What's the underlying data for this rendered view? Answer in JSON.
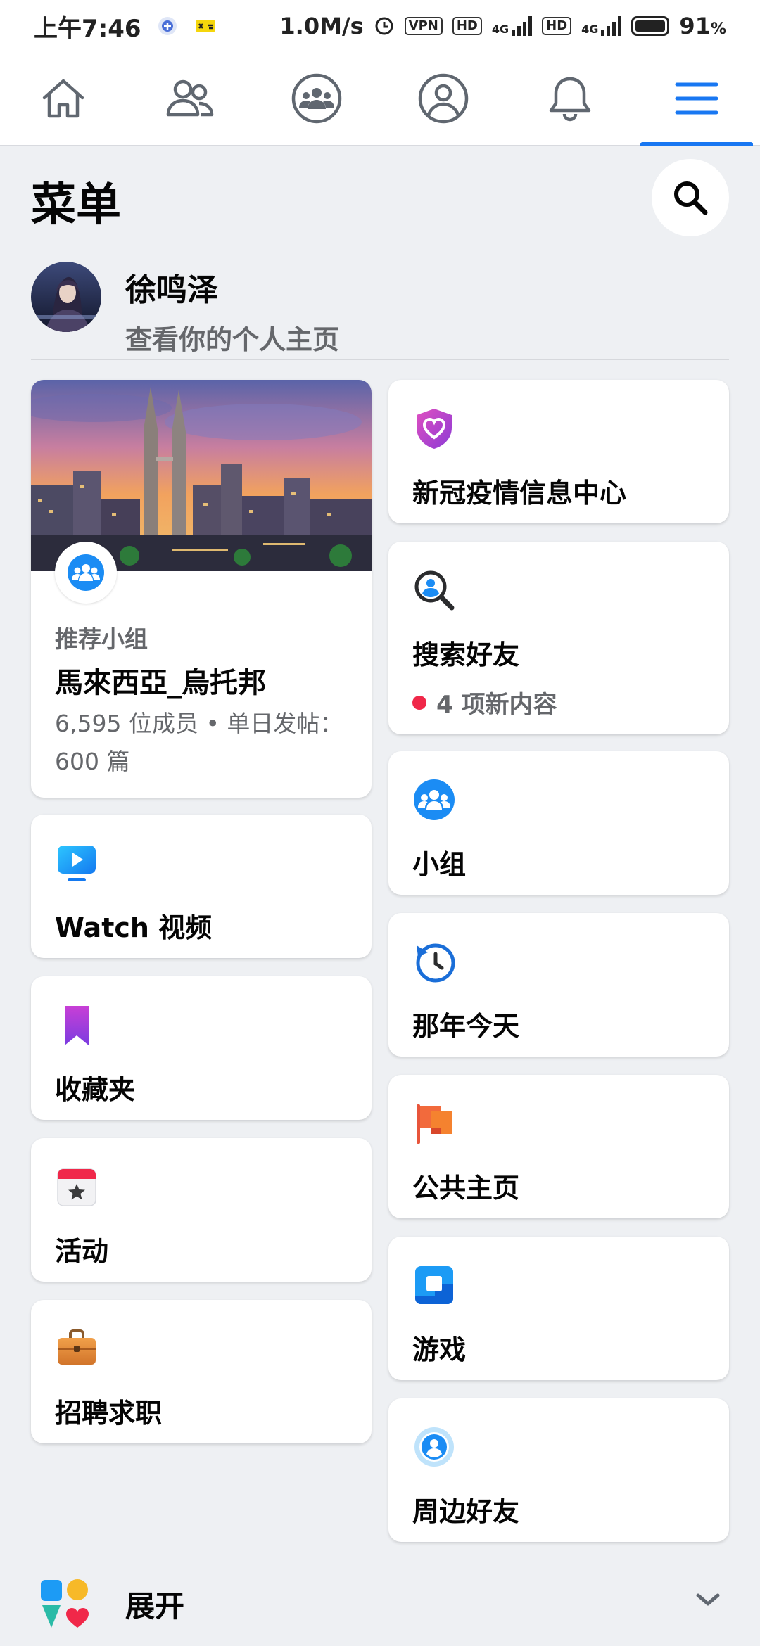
{
  "status_bar": {
    "time": "上午7:46",
    "speed": "1.0M/s",
    "vpn": "VPN",
    "hd": "HD",
    "network": "4G",
    "battery": "91",
    "battery_unit": "%"
  },
  "nav": {
    "tabs": [
      {
        "name": "home-icon"
      },
      {
        "name": "friends-icon"
      },
      {
        "name": "groups-icon"
      },
      {
        "name": "profile-icon"
      },
      {
        "name": "bell-icon"
      },
      {
        "name": "menu-icon",
        "active": true
      }
    ],
    "accent": "#1877f2"
  },
  "header": {
    "title": "菜单"
  },
  "profile": {
    "name": "徐鸣泽",
    "subtitle": "查看你的个人主页"
  },
  "group_card": {
    "kicker": "推荐小组",
    "title": "馬來西亞_烏托邦",
    "meta": "6,595 位成员 • 单日发帖：600 篇"
  },
  "left_items": [
    {
      "label": "Watch 视频",
      "icon": "watch-video-icon"
    },
    {
      "label": "收藏夹",
      "icon": "bookmark-icon"
    },
    {
      "label": "活动",
      "icon": "calendar-event-icon"
    },
    {
      "label": "招聘求职",
      "icon": "briefcase-icon"
    }
  ],
  "right_items": [
    {
      "label": "新冠疫情信息中心",
      "icon": "heart-shield-icon"
    },
    {
      "label": "搜索好友",
      "icon": "find-friends-icon",
      "badge": "4 项新内容"
    },
    {
      "label": "小组",
      "icon": "groups-icon"
    },
    {
      "label": "那年今天",
      "icon": "memories-clock-icon"
    },
    {
      "label": "公共主页",
      "icon": "flag-icon"
    },
    {
      "label": "游戏",
      "icon": "gaming-icon"
    },
    {
      "label": "周边好友",
      "icon": "nearby-friends-icon"
    }
  ],
  "expand": {
    "label": "展开"
  }
}
